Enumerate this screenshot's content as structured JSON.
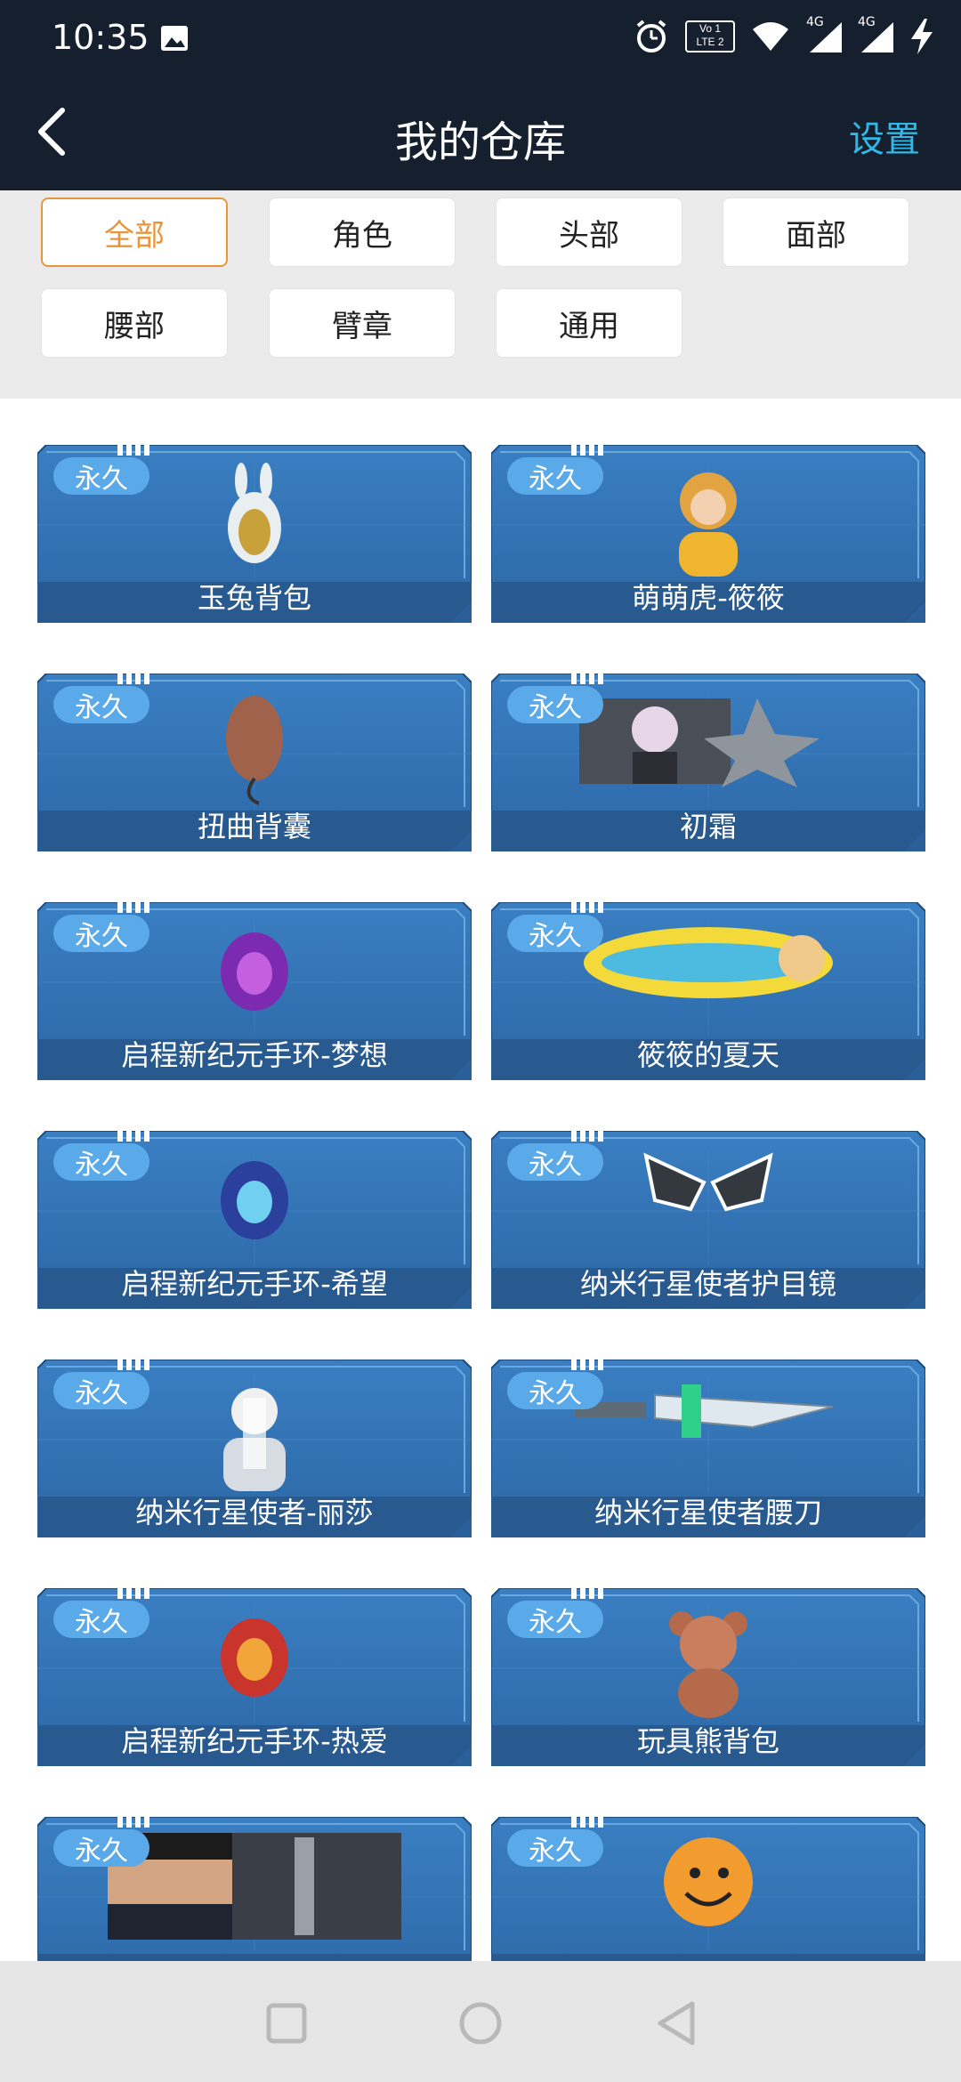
{
  "status_bar": {
    "time": "10:35",
    "lte_label": "LTE 2",
    "volte_label": "Vo 1",
    "net1": "4G",
    "net2": "4G"
  },
  "header": {
    "title": "我的仓库",
    "settings_label": "设置"
  },
  "filters": [
    "全部",
    "角色",
    "头部",
    "面部",
    "腰部",
    "臂章",
    "通用"
  ],
  "active_filter": "全部",
  "items": [
    {
      "name": "玉兔背包",
      "badge": "永久",
      "icon": "rabbit-backpack-icon"
    },
    {
      "name": "萌萌虎-筱筱",
      "badge": "永久",
      "icon": "tiger-character-icon"
    },
    {
      "name": "扭曲背囊",
      "badge": "永久",
      "icon": "twisted-pouch-icon"
    },
    {
      "name": "初霜",
      "badge": "永久",
      "icon": "character-portrait-icon"
    },
    {
      "name": "启程新纪元手环-梦想",
      "badge": "永久",
      "icon": "bracelet-purple-icon"
    },
    {
      "name": "筱筱的夏天",
      "badge": "永久",
      "icon": "surfboard-icon"
    },
    {
      "name": "启程新纪元手环-希望",
      "badge": "永久",
      "icon": "bracelet-blue-icon"
    },
    {
      "name": "纳米行星使者护目镜",
      "badge": "永久",
      "icon": "goggles-icon"
    },
    {
      "name": "纳米行星使者-丽莎",
      "badge": "永久",
      "icon": "white-hair-character-icon"
    },
    {
      "name": "纳米行星使者腰刀",
      "badge": "永久",
      "icon": "knife-icon"
    },
    {
      "name": "启程新纪元手环-热爱",
      "badge": "永久",
      "icon": "bracelet-red-icon"
    },
    {
      "name": "玩具熊背包",
      "badge": "永久",
      "icon": "teddy-bear-icon"
    },
    {
      "name": "",
      "badge": "永久",
      "icon": "male-character-portrait-icon"
    },
    {
      "name": "",
      "badge": "永久",
      "icon": "smiley-face-icon"
    }
  ],
  "colors": {
    "accent": "#e8963b",
    "header_bg": "#161f2d",
    "settings": "#31b8e6",
    "card_blue": "#2f6fb0",
    "badge": "#5aa9e8"
  }
}
